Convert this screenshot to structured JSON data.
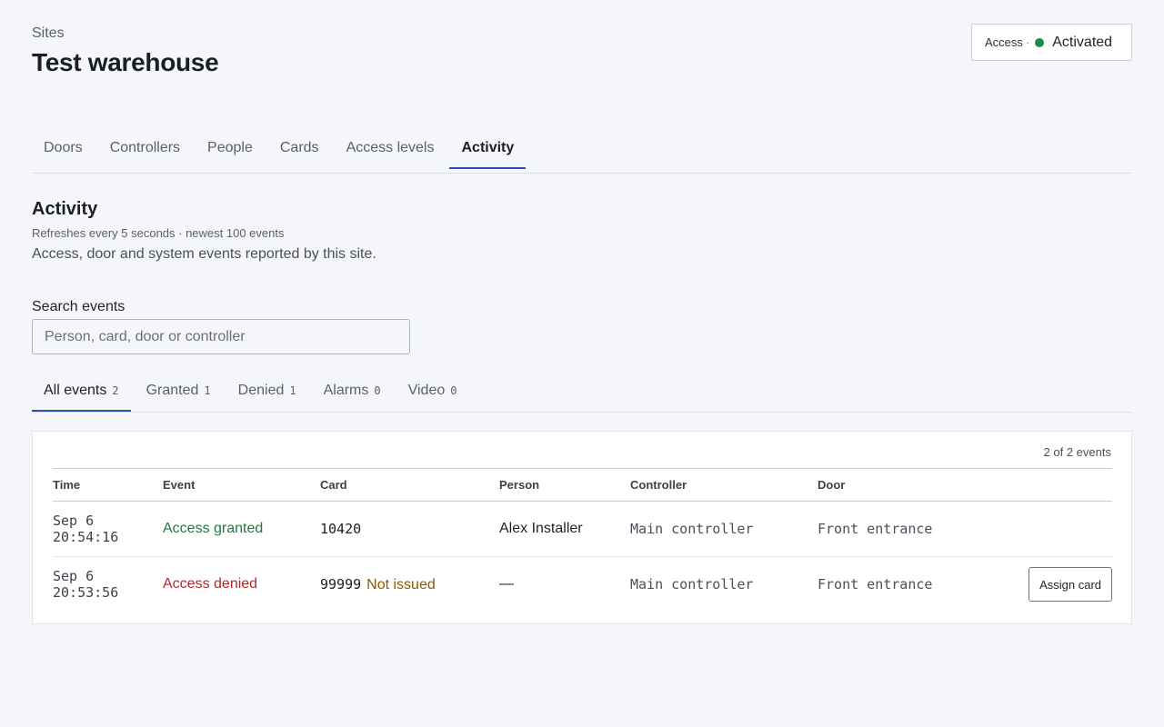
{
  "header": {
    "breadcrumb": "Sites",
    "title": "Test warehouse",
    "status": {
      "key": "Access",
      "separator": "·",
      "value": "Activated",
      "color": "#1e8a4c"
    }
  },
  "tabs": [
    {
      "label": "Doors",
      "active": false
    },
    {
      "label": "Controllers",
      "active": false
    },
    {
      "label": "People",
      "active": false
    },
    {
      "label": "Cards",
      "active": false
    },
    {
      "label": "Access levels",
      "active": false
    },
    {
      "label": "Activity",
      "active": true
    }
  ],
  "section": {
    "title": "Activity",
    "meta": "Refreshes every 5 seconds · newest 100 events",
    "description": "Access, door and system events reported by this site."
  },
  "search": {
    "label": "Search events",
    "placeholder": "Person, card, door or controller",
    "value": ""
  },
  "filters": [
    {
      "label": "All events",
      "count": "2",
      "active": true
    },
    {
      "label": "Granted",
      "count": "1",
      "active": false
    },
    {
      "label": "Denied",
      "count": "1",
      "active": false
    },
    {
      "label": "Alarms",
      "count": "0",
      "active": false
    },
    {
      "label": "Video",
      "count": "0",
      "active": false
    }
  ],
  "table": {
    "count_text": "2 of 2 events",
    "columns": [
      "Time",
      "Event",
      "Card",
      "Person",
      "Controller",
      "Door"
    ],
    "rows": [
      {
        "date": "Sep 6",
        "time": "20:54:16",
        "event": "Access granted",
        "status": "granted",
        "card": "10420",
        "card_note": "",
        "person": "Alex Installer",
        "controller": "Main controller",
        "door": "Front entrance",
        "action": ""
      },
      {
        "date": "Sep 6",
        "time": "20:53:56",
        "event": "Access denied",
        "status": "denied",
        "card": "99999",
        "card_note": "Not issued",
        "person": "—",
        "controller": "Main controller",
        "door": "Front entrance",
        "action": "Assign card"
      }
    ]
  },
  "colors": {
    "accent": "#2a4fb8",
    "granted": "#1e7a3e",
    "denied": "#b42828",
    "warning": "#8a5a00"
  }
}
